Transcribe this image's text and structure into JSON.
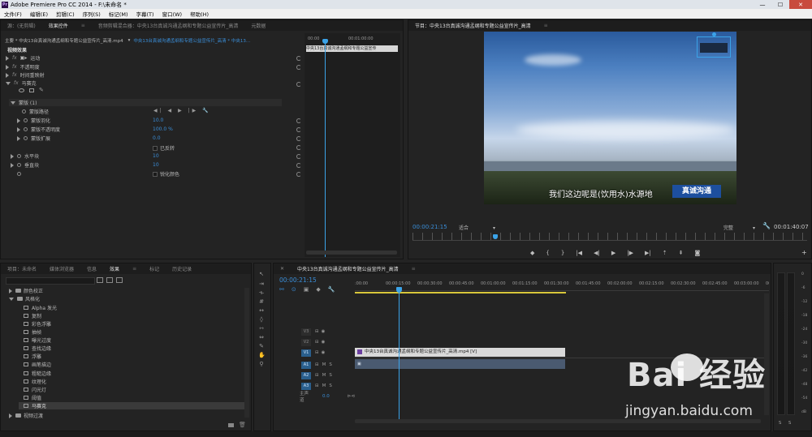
{
  "window": {
    "title": "Adobe Premiere Pro CC 2014 - F:\\未命名 *",
    "app_icon": "Pr",
    "buttons": [
      "—",
      "☐",
      "✕"
    ]
  },
  "menu": [
    "文件(F)",
    "编辑(E)",
    "剪辑(C)",
    "序列(S)",
    "标记(M)",
    "字幕(T)",
    "窗口(W)",
    "帮助(H)"
  ],
  "source_tabs": [
    "源：(无剪辑)",
    "效果控件",
    "音频剪辑混合器：中央13台真诚沟通孟纲和专题公益宣传片_高清",
    "元数据"
  ],
  "effect_controls": {
    "header": "主要 * 中央13台真诚沟通孟纲和专题公益宣传片_高清.mp4",
    "header2": "中央13台真诚沟通孟纲和专题公益宣传片_高清 * 中央13...",
    "section": "视频效果",
    "fx": [
      "运动",
      "不透明度",
      "时间重映射",
      "马赛克"
    ],
    "mask": "蒙版 (1)",
    "mask_rows": [
      {
        "label": "蒙版路径",
        "value": ""
      },
      {
        "label": "蒙版羽化",
        "value": "10.0"
      },
      {
        "label": "蒙版不透明度",
        "value": "100.0 %"
      },
      {
        "label": "蒙版扩展",
        "value": "0.0"
      }
    ],
    "inverted": "已反转",
    "block_rows": [
      {
        "label": "水平块",
        "value": "10"
      },
      {
        "label": "垂直块",
        "value": "10"
      }
    ],
    "sharpen": "锐化颜色",
    "mini_clip": "中央13台真诚沟通孟纲和专题公益宣传",
    "times": [
      "00:00",
      "00:01:00:00"
    ]
  },
  "program": {
    "tab": "节目：中央13台真诚沟通孟纲和专题公益宣传片_高清",
    "subtitle": "我们这边呢是(饮用水)水源地",
    "logo_text": "真诚沟通",
    "timecode": "00:00:21:15",
    "zoom": "适合",
    "quality": "完整",
    "duration": "00:01:40:07"
  },
  "project_tabs": [
    "项目：未命名",
    "媒体浏览器",
    "信息",
    "效果",
    "标记",
    "历史记录"
  ],
  "effects_tree": {
    "color_folder": "颜色校正",
    "stylize": "风格化",
    "items": [
      "Alpha 发光",
      "复制",
      "彩色浮雕",
      "抽帧",
      "曝光过度",
      "查找边缘",
      "浮雕",
      "画笔描边",
      "粗糙边缘",
      "纹理化",
      "闪光灯",
      "阈值",
      "马赛克"
    ],
    "video_transitions": "视频过渡"
  },
  "timeline": {
    "tab": "中央13台真诚沟通孟纲和专题公益宣传片_高清",
    "timecode": "00:00:21:15",
    "ruler": [
      ":00:00",
      "00:00:15:00",
      "00:00:30:00",
      "00:00:45:00",
      "00:01:00:00",
      "00:01:15:00",
      "00:01:30:00",
      "00:01:45:00",
      "00:02:00:00",
      "00:02:15:00",
      "00:02:30:00",
      "00:02:45:00",
      "00:03:00:00",
      "00:03:15:00",
      "00"
    ],
    "tracks": [
      {
        "name": "V3",
        "target": false
      },
      {
        "name": "V2",
        "target": false
      },
      {
        "name": "V1",
        "target": true
      },
      {
        "name": "A1",
        "target": true
      },
      {
        "name": "A2",
        "target": true
      },
      {
        "name": "A3",
        "target": true
      }
    ],
    "master": "主声道",
    "master_value": "0.0",
    "video_clip": "中央13台真诚沟通孟纲和专题公益宣传片_高清.mp4 [V]",
    "audio_clip": "",
    "ms": [
      "M",
      "S"
    ]
  },
  "meter": {
    "scale": [
      "0",
      "-6",
      "-12",
      "-18",
      "-24",
      "-30",
      "-36",
      "-42",
      "-48",
      "-54",
      "dB"
    ],
    "bottom": [
      "S",
      "S"
    ]
  },
  "watermark": {
    "text": "Bai  经验",
    "url": "jingyan.baidu.com"
  },
  "colors": {
    "accent": "#3a8ed8",
    "playhead": "#3ba3e8",
    "clip_video": "#d9d9d9",
    "clip_audio": "#4a5a70"
  }
}
